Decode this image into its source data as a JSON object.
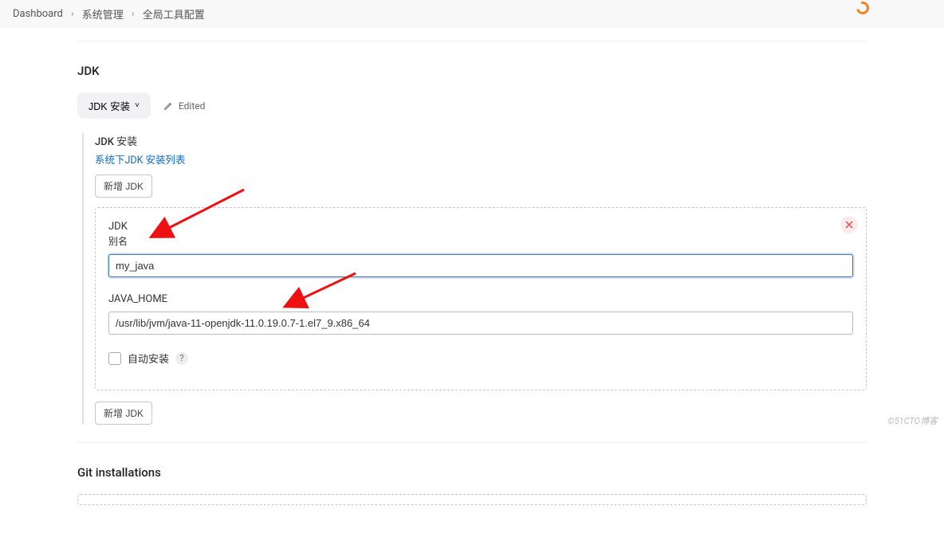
{
  "breadcrumb": {
    "items": [
      "Dashboard",
      "系统管理",
      "全局工具配置"
    ]
  },
  "section_jdk": {
    "title": "JDK",
    "collapse_button": "JDK 安装",
    "edited_label": "Edited",
    "list_header": "JDK 安装",
    "list_sub": "系统下JDK 安装列表",
    "add_btn_top": "新增 JDK",
    "add_btn_bottom": "新增 JDK"
  },
  "jdk_form": {
    "name_label_line1": "JDK",
    "name_label_line2": "别名",
    "name_value": "my_java",
    "home_label": "JAVA_HOME",
    "home_value": "/usr/lib/jvm/java-11-openjdk-11.0.19.0.7-1.el7_9.x86_64",
    "auto_install_label": "自动安装"
  },
  "section_git": {
    "title": "Git installations"
  },
  "watermark": "©51CTO博客"
}
